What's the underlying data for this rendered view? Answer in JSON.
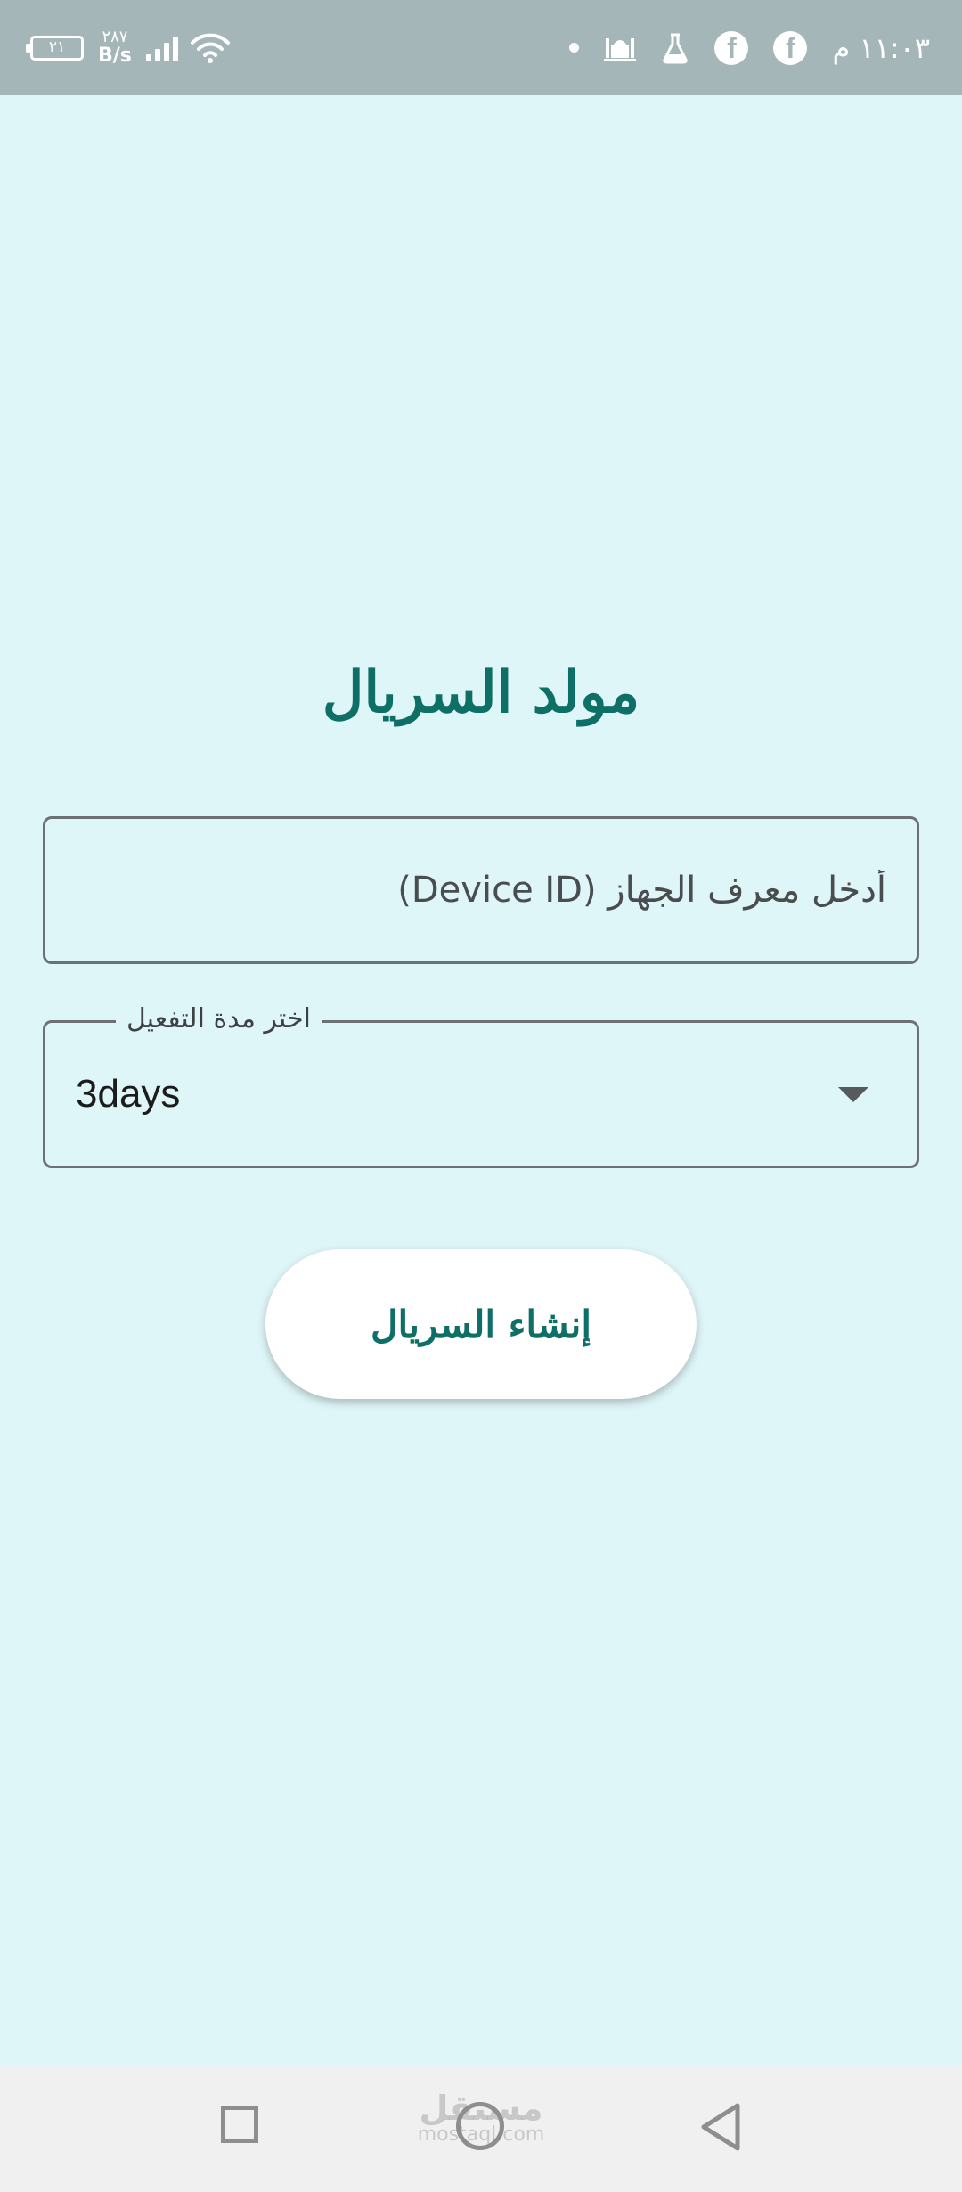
{
  "status_bar": {
    "battery_level": "٢١",
    "net_speed_value": "٢٨٧",
    "net_speed_unit": "B/s",
    "time": "١١:٠٣ م",
    "icons": [
      "battery-icon",
      "signal-icon",
      "wifi-icon",
      "notification-dot-icon",
      "mosque-icon",
      "flask-icon",
      "facebook-icon",
      "facebook-icon"
    ]
  },
  "main": {
    "title": "مولد السريال",
    "device_input": {
      "placeholder": "أدخل معرف الجهاز (Device ID)",
      "value": ""
    },
    "duration_select": {
      "label": "اختر مدة التفعيل",
      "selected": "3days"
    },
    "generate_button_label": "إنشاء السريال"
  },
  "nav_bar": {
    "watermark_main": "مستقل",
    "watermark_sub": "mostaql.com"
  },
  "colors": {
    "background": "#dff6f8",
    "status_bar": "#a5b6b8",
    "accent": "#0d6f66",
    "nav_bar": "#f0f0f0"
  }
}
